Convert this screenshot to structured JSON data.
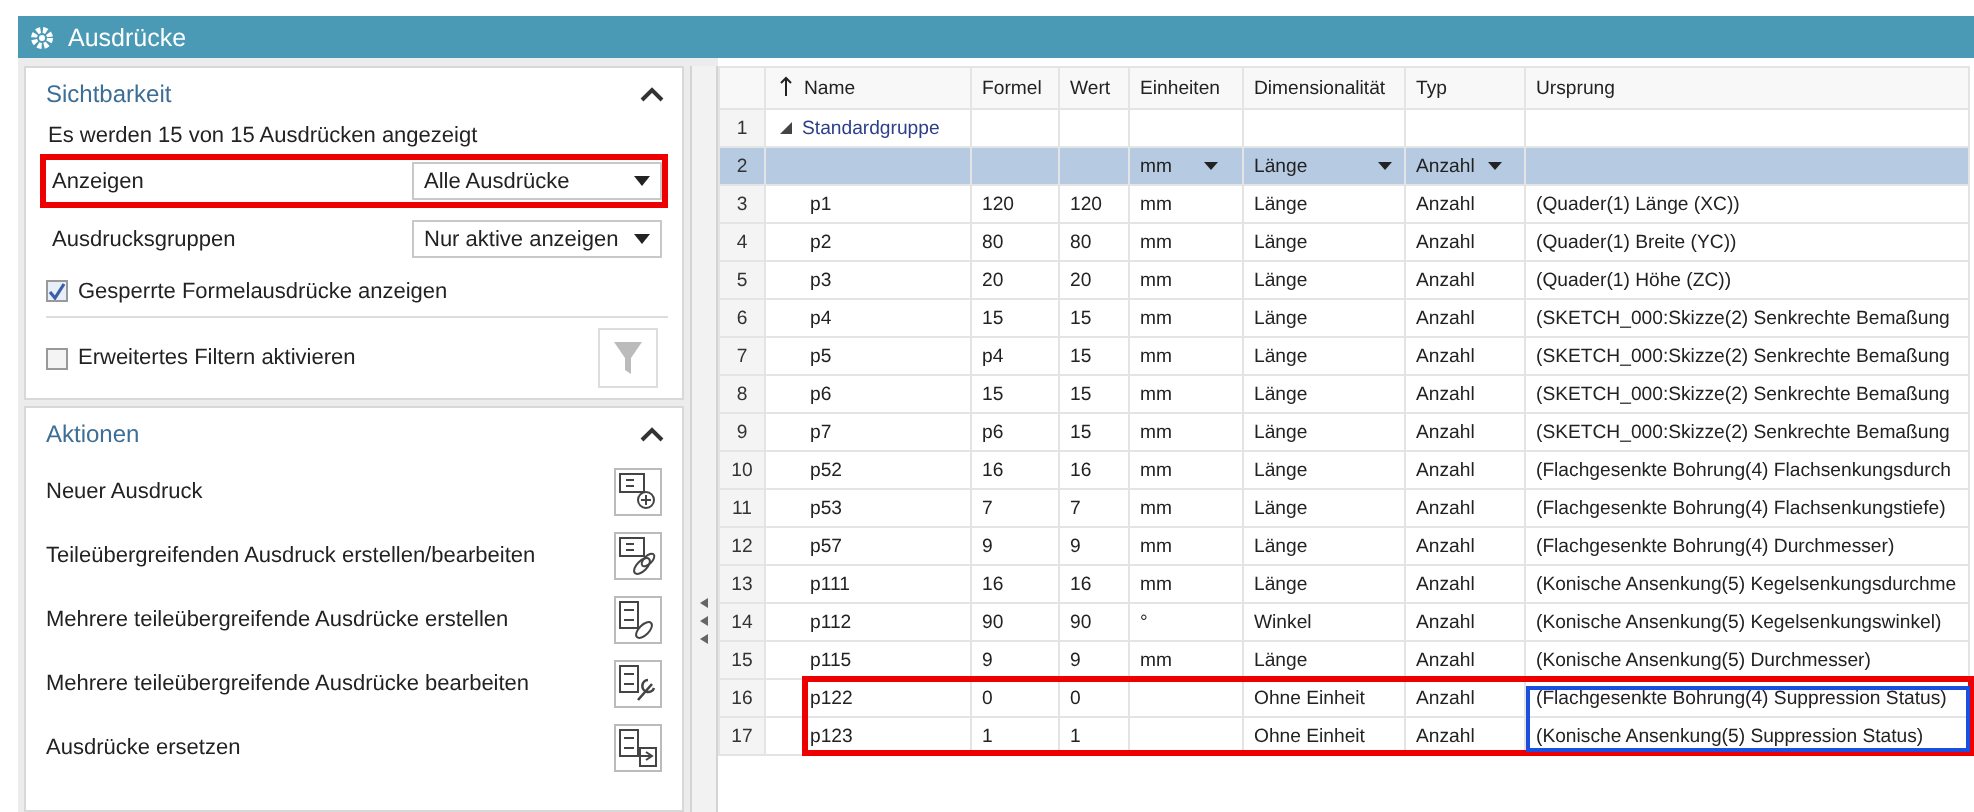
{
  "window": {
    "title": "Ausdrücke"
  },
  "visibility": {
    "title": "Sichtbarkeit",
    "expanded": true,
    "summary": "Es werden 15 von 15 Ausdrücken angezeigt",
    "fields": [
      {
        "label": "Anzeigen",
        "value": "Alle Ausdrücke",
        "marked": true
      },
      {
        "label": "Ausdrucksgruppen",
        "value": "Nur aktive anzeigen",
        "marked": false
      }
    ],
    "checkboxes": [
      {
        "label": "Gesperrte Formelausdrücke anzeigen",
        "checked": true
      },
      {
        "label": "Erweitertes Filtern aktivieren",
        "checked": false
      }
    ]
  },
  "actions": {
    "title": "Aktionen",
    "expanded": true,
    "items": [
      {
        "label": "Neuer Ausdruck",
        "kind": "new"
      },
      {
        "label": "Teileübergreifenden Ausdruck erstellen/bearbeiten",
        "kind": "link"
      },
      {
        "label": "Mehrere teileübergreifende Ausdrücke erstellen",
        "kind": "multi-link"
      },
      {
        "label": "Mehrere teileübergreifende Ausdrücke bearbeiten",
        "kind": "multi-edit"
      },
      {
        "label": "Ausdrücke ersetzen",
        "kind": "replace"
      }
    ]
  },
  "table": {
    "columns": [
      {
        "label": "Name",
        "sorted": true
      },
      {
        "label": "Formel",
        "sorted": false
      },
      {
        "label": "Wert",
        "sorted": false
      },
      {
        "label": "Einheiten",
        "sorted": false
      },
      {
        "label": "Dimensionalität",
        "sorted": false
      },
      {
        "label": "Typ",
        "sorted": false
      },
      {
        "label": "Ursprung",
        "sorted": false
      }
    ],
    "rows": [
      {
        "number": "1",
        "kind": "group",
        "name": "Standardgruppe",
        "expanded": true
      },
      {
        "number": "2",
        "kind": "filter",
        "units": "mm",
        "dimensionality": "Länge",
        "type": "Anzahl"
      },
      {
        "number": "3",
        "kind": "expression",
        "name": "p1",
        "formula": "120",
        "value": "120",
        "units": "mm",
        "dimensionality": "Länge",
        "type": "Anzahl",
        "origin": "(Quader(1) Länge (XC))",
        "marked": false,
        "origin_marked": false
      },
      {
        "number": "4",
        "kind": "expression",
        "name": "p2",
        "formula": "80",
        "value": "80",
        "units": "mm",
        "dimensionality": "Länge",
        "type": "Anzahl",
        "origin": "(Quader(1) Breite (YC))",
        "marked": false,
        "origin_marked": false
      },
      {
        "number": "5",
        "kind": "expression",
        "name": "p3",
        "formula": "20",
        "value": "20",
        "units": "mm",
        "dimensionality": "Länge",
        "type": "Anzahl",
        "origin": "(Quader(1) Höhe (ZC))",
        "marked": false,
        "origin_marked": false
      },
      {
        "number": "6",
        "kind": "expression",
        "name": "p4",
        "formula": "15",
        "value": "15",
        "units": "mm",
        "dimensionality": "Länge",
        "type": "Anzahl",
        "origin": "(SKETCH_000:Skizze(2) Senkrechte Bemaßung",
        "marked": false,
        "origin_marked": false
      },
      {
        "number": "7",
        "kind": "expression",
        "name": "p5",
        "formula": "p4",
        "value": "15",
        "units": "mm",
        "dimensionality": "Länge",
        "type": "Anzahl",
        "origin": "(SKETCH_000:Skizze(2) Senkrechte Bemaßung",
        "marked": false,
        "origin_marked": false
      },
      {
        "number": "8",
        "kind": "expression",
        "name": "p6",
        "formula": "15",
        "value": "15",
        "units": "mm",
        "dimensionality": "Länge",
        "type": "Anzahl",
        "origin": "(SKETCH_000:Skizze(2) Senkrechte Bemaßung",
        "marked": false,
        "origin_marked": false
      },
      {
        "number": "9",
        "kind": "expression",
        "name": "p7",
        "formula": "p6",
        "value": "15",
        "units": "mm",
        "dimensionality": "Länge",
        "type": "Anzahl",
        "origin": "(SKETCH_000:Skizze(2) Senkrechte Bemaßung",
        "marked": false,
        "origin_marked": false
      },
      {
        "number": "10",
        "kind": "expression",
        "name": "p52",
        "formula": "16",
        "value": "16",
        "units": "mm",
        "dimensionality": "Länge",
        "type": "Anzahl",
        "origin": "(Flachgesenkte Bohrung(4) Flachsenkungsdurch",
        "marked": false,
        "origin_marked": false
      },
      {
        "number": "11",
        "kind": "expression",
        "name": "p53",
        "formula": "7",
        "value": "7",
        "units": "mm",
        "dimensionality": "Länge",
        "type": "Anzahl",
        "origin": "(Flachgesenkte Bohrung(4) Flachsenkungstiefe)",
        "marked": false,
        "origin_marked": false
      },
      {
        "number": "12",
        "kind": "expression",
        "name": "p57",
        "formula": "9",
        "value": "9",
        "units": "mm",
        "dimensionality": "Länge",
        "type": "Anzahl",
        "origin": "(Flachgesenkte Bohrung(4) Durchmesser)",
        "marked": false,
        "origin_marked": false
      },
      {
        "number": "13",
        "kind": "expression",
        "name": "p111",
        "formula": "16",
        "value": "16",
        "units": "mm",
        "dimensionality": "Länge",
        "type": "Anzahl",
        "origin": "(Konische Ansenkung(5) Kegelsenkungsdurchme",
        "marked": false,
        "origin_marked": false
      },
      {
        "number": "14",
        "kind": "expression",
        "name": "p112",
        "formula": "90",
        "value": "90",
        "units": "°",
        "dimensionality": "Winkel",
        "type": "Anzahl",
        "origin": "(Konische Ansenkung(5) Kegelsenkungswinkel)",
        "marked": false,
        "origin_marked": false
      },
      {
        "number": "15",
        "kind": "expression",
        "name": "p115",
        "formula": "9",
        "value": "9",
        "units": "mm",
        "dimensionality": "Länge",
        "type": "Anzahl",
        "origin": "(Konische Ansenkung(5) Durchmesser)",
        "marked": false,
        "origin_marked": false
      },
      {
        "number": "16",
        "kind": "expression",
        "name": "p122",
        "formula": "0",
        "value": "0",
        "dimensionality": "Ohne Einheit",
        "type": "Anzahl",
        "origin": "(Flachgesenkte Bohrung(4) Suppression Status)",
        "marked": true,
        "origin_marked": true
      },
      {
        "number": "17",
        "kind": "expression",
        "name": "p123",
        "formula": "1",
        "value": "1",
        "dimensionality": "Ohne Einheit",
        "type": "Anzahl",
        "origin": "(Konische Ansenkung(5) Suppression Status)",
        "marked": true,
        "origin_marked": true
      }
    ]
  }
}
